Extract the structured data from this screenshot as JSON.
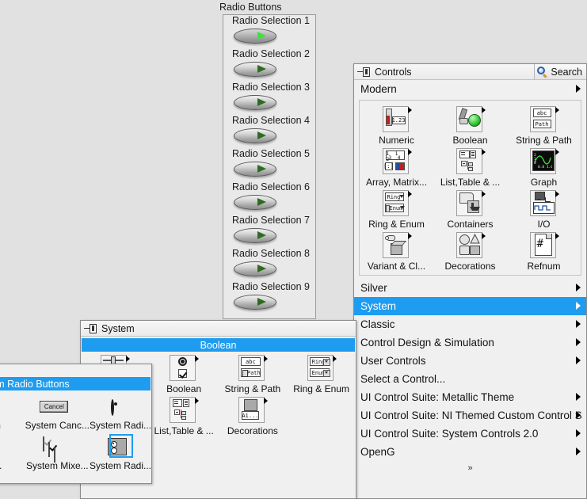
{
  "desktop": {
    "background_color": "#e1e1e1"
  },
  "radio_panel": {
    "label": "Radio Buttons",
    "items": [
      {
        "label": "Radio Selection 1",
        "selected": true
      },
      {
        "label": "Radio Selection 2",
        "selected": false
      },
      {
        "label": "Radio Selection 3",
        "selected": false
      },
      {
        "label": "Radio Selection 4",
        "selected": false
      },
      {
        "label": "Radio Selection 5",
        "selected": false
      },
      {
        "label": "Radio Selection 6",
        "selected": false
      },
      {
        "label": "Radio Selection 7",
        "selected": false
      },
      {
        "label": "Radio Selection 8",
        "selected": false
      },
      {
        "label": "Radio Selection 9",
        "selected": false
      }
    ]
  },
  "controls_palette": {
    "title": "Controls",
    "pin_icon": "pin-icon",
    "search_label": "Search",
    "search_icon": "magnifier-icon",
    "current_category": "Modern",
    "modern_items": [
      {
        "label": "Numeric",
        "icon": "numeric-icon"
      },
      {
        "label": "Boolean",
        "icon": "boolean-icon"
      },
      {
        "label": "String & Path",
        "icon": "string-path-icon"
      },
      {
        "label": "Array, Matrix...",
        "icon": "array-matrix-icon"
      },
      {
        "label": "List,Table & ...",
        "icon": "list-table-icon"
      },
      {
        "label": "Graph",
        "icon": "graph-icon"
      },
      {
        "label": "Ring & Enum",
        "icon": "ring-enum-icon"
      },
      {
        "label": "Containers",
        "icon": "containers-icon"
      },
      {
        "label": "I/O",
        "icon": "io-icon"
      },
      {
        "label": "Variant & Cl...",
        "icon": "variant-class-icon"
      },
      {
        "label": "Decorations",
        "icon": "decorations-icon"
      },
      {
        "label": "Refnum",
        "icon": "refnum-icon"
      }
    ],
    "category_rows": [
      {
        "label": "Silver",
        "has_submenu": true,
        "selected": false
      },
      {
        "label": "System",
        "has_submenu": true,
        "selected": true
      },
      {
        "label": "Classic",
        "has_submenu": true,
        "selected": false
      },
      {
        "label": "Control Design & Simulation",
        "has_submenu": true,
        "selected": false
      },
      {
        "label": "User Controls",
        "has_submenu": true,
        "selected": false
      },
      {
        "label": "Select a Control...",
        "has_submenu": false,
        "selected": false
      },
      {
        "label": "UI Control Suite: Metallic Theme",
        "has_submenu": true,
        "selected": false
      },
      {
        "label": "UI Control Suite: NI Themed Custom Control S",
        "has_submenu": true,
        "selected": false
      },
      {
        "label": "UI Control Suite: System Controls 2.0",
        "has_submenu": true,
        "selected": false
      },
      {
        "label": "OpenG",
        "has_submenu": true,
        "selected": false
      }
    ],
    "scroll_down_glyph": "»"
  },
  "system_palette": {
    "title": "System",
    "pin_icon": "pin-icon",
    "highlight_label": "Boolean",
    "items": [
      {
        "label": "",
        "icon": "system-slide-icon"
      },
      {
        "label": "Boolean",
        "icon": "system-boolean-icon"
      },
      {
        "label": "String & Path",
        "icon": "system-string-path-icon"
      },
      {
        "label": "Ring & Enum",
        "icon": "system-ring-enum-icon"
      },
      {
        "label": "",
        "icon": "system-numeric-icon"
      },
      {
        "label": "List,Table & ...",
        "icon": "system-list-table-icon"
      },
      {
        "label": "Decorations",
        "icon": "system-decorations-icon"
      },
      {
        "label": "",
        "icon": "blank-icon"
      }
    ]
  },
  "sysradio_popup": {
    "window_title": "n",
    "highlight_label": "System Radio Buttons",
    "items": [
      {
        "label": "on",
        "icon": "clipped-icon",
        "selected": false
      },
      {
        "label": "System Canc...",
        "icon": "system-cancel-button-icon",
        "selected": false
      },
      {
        "label": "System Radi...",
        "icon": "system-radio-button-icon",
        "selected": false
      },
      {
        "label": "c...",
        "icon": "clipped-icon",
        "selected": false
      },
      {
        "label": "System Mixe...",
        "icon": "system-mixed-checkbox-icon",
        "selected": false
      },
      {
        "label": "System Radi...",
        "icon": "system-radio-buttons-icon",
        "selected": true
      }
    ],
    "cancel_button_label": "Cancel",
    "a1_label": "A1..."
  },
  "colors": {
    "accent_blue": "#1e9cf0",
    "panel_gray": "#f0f0f0",
    "desktop_gray": "#e1e1e1",
    "led_green_on": "#3fe03f",
    "led_green_off": "#2f6b1f"
  }
}
